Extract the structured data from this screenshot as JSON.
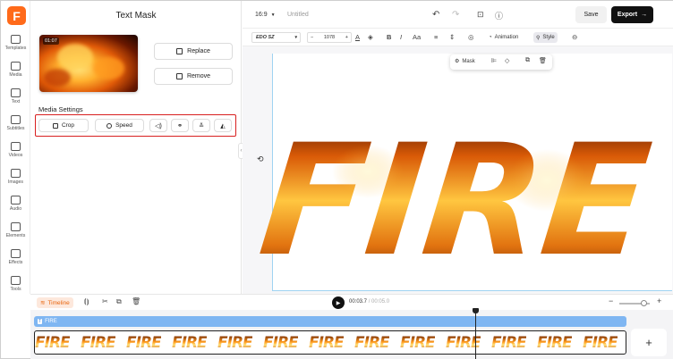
{
  "rail": {
    "logo": "F",
    "items": [
      {
        "label": "Templates",
        "icon": "templates-icon"
      },
      {
        "label": "Media",
        "icon": "media-icon"
      },
      {
        "label": "Text",
        "icon": "text-icon"
      },
      {
        "label": "Subtitles",
        "icon": "subtitles-icon"
      },
      {
        "label": "Videos",
        "icon": "videos-icon"
      },
      {
        "label": "Images",
        "icon": "images-icon"
      },
      {
        "label": "Audio",
        "icon": "audio-icon"
      },
      {
        "label": "Elements",
        "icon": "elements-icon"
      },
      {
        "label": "Effects",
        "icon": "effects-icon"
      },
      {
        "label": "Tools",
        "icon": "tools-icon"
      }
    ]
  },
  "panel": {
    "title": "Text Mask",
    "thumb_duration": "01:07",
    "replace_label": "Replace",
    "remove_label": "Remove",
    "media_settings_label": "Media Settings",
    "crop_label": "Crop",
    "speed_label": "Speed",
    "highlight_color": "#d81f1f"
  },
  "topbar": {
    "ratio": "16:9",
    "title": "Untitled",
    "save_label": "Save",
    "export_label": "Export"
  },
  "textbar": {
    "font": "EDO SZ",
    "size": "1078",
    "animation_label": "Animation",
    "style_label": "Style"
  },
  "canvas": {
    "mask_label": "Mask",
    "text": "FIRE"
  },
  "timeline": {
    "tab_label": "Timeline",
    "current_time": "00:03.7",
    "total_time": "/ 00:05.0",
    "zoom_level": 0.8,
    "text_track_label": "FIRE",
    "video_tile_text": "FIRE",
    "accent_color": "#e8660f",
    "text_track_color": "#7fb6f2"
  }
}
